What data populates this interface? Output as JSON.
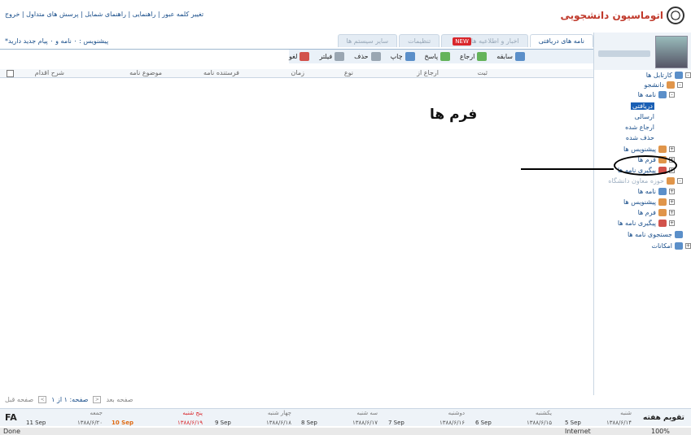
{
  "header": {
    "links": "تغییر کلمه عبور | راهنمایی | راهنمای شمایل | پرسش های متداول | خروج",
    "logo_text": "اتوماسیون دانشجویی"
  },
  "tabs": [
    {
      "label": "نامه های دریافتی",
      "active": true
    },
    {
      "label": "اخبار و اطلاعیه ها",
      "badge": "NEW"
    },
    {
      "label": "تنظیمات"
    },
    {
      "label": "سایر سیستم ها"
    }
  ],
  "notice": "*پیشنویس : ۰ نامه و ۰ پیام جدید دارید",
  "toolbar": {
    "history": "سابقه",
    "refer": "ارجاع",
    "reply": "پاسخ",
    "print": "چاپ",
    "delete": "حذف",
    "filter": "فیلتر",
    "cancel": "لغو"
  },
  "columns": [
    "ثبت",
    "ارجاع از",
    "نوع",
    "زمان",
    "فرستنده نامه",
    "موضوع نامه",
    "شرح اقدام"
  ],
  "tree": {
    "root": "کارتابل ها",
    "student": "دانشجو",
    "letters": "نامه ها",
    "received": "دریافتی",
    "sent": "ارسالی",
    "referred": "ارجاع شده",
    "deleted": "حذف شده",
    "drafts": "پیشنویس ها",
    "forms": "فرم ها",
    "tracking": "پیگیری نامه ها",
    "section2": "حوزه معاون دانشگاه",
    "letters2": "نامه ها",
    "drafts2": "پیشنویس ها",
    "forms2": "فرم ها",
    "tracking2": "پیگیری نامه ها",
    "search": "جستجوی نامه ها",
    "features": "امکانات"
  },
  "annotation": "فرم ها",
  "pager": {
    "prev": "صفحه قبل",
    "page": "صفحه: ۱ از ۱",
    "next": "صفحه بعد"
  },
  "calendar": {
    "label_fa": "FA",
    "title": "تقویم هفته",
    "days": [
      {
        "name": "شنبه",
        "greg": "5 Sep",
        "persian": "۱۳۸۸/۶/۱۴"
      },
      {
        "name": "یکشنبه",
        "greg": "6 Sep",
        "persian": "۱۳۸۸/۶/۱۵"
      },
      {
        "name": "دوشنبه",
        "greg": "7 Sep",
        "persian": "۱۳۸۸/۶/۱۶"
      },
      {
        "name": "سه شنبه",
        "greg": "8 Sep",
        "persian": "۱۳۸۸/۶/۱۷"
      },
      {
        "name": "چهار شنبه",
        "greg": "9 Sep",
        "persian": "۱۳۸۸/۶/۱۸"
      },
      {
        "name": "پنج شنبه",
        "greg": "10 Sep",
        "persian": "۱۳۸۸/۶/۱۹"
      },
      {
        "name": "جمعه",
        "greg": "11 Sep",
        "persian": "۱۳۸۸/۶/۲۰"
      }
    ]
  },
  "status": {
    "left": "Done",
    "zone": "Internet",
    "zoom": "100%"
  }
}
